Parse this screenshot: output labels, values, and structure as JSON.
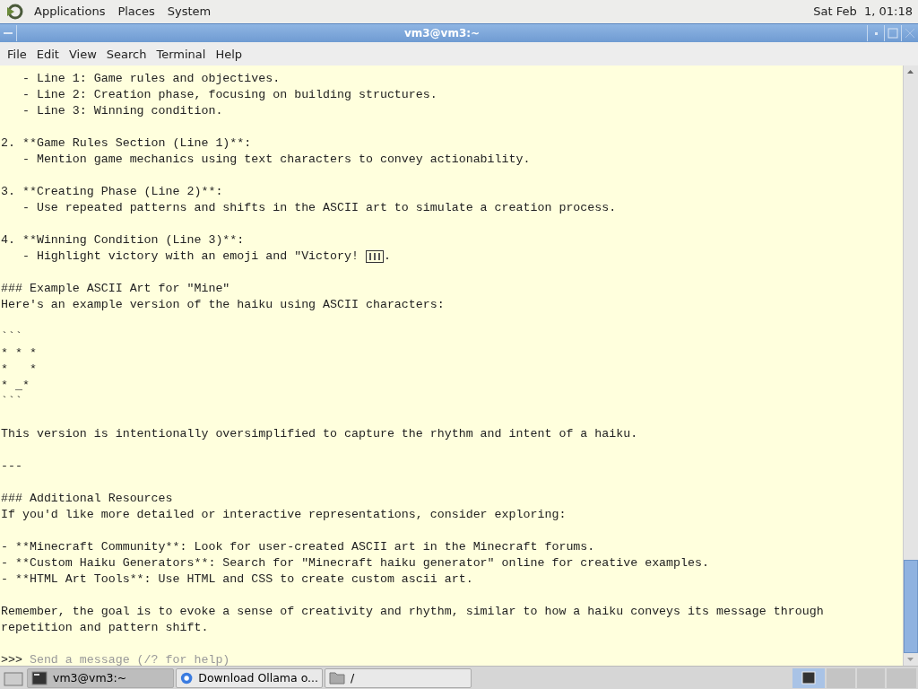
{
  "top_panel": {
    "menus": [
      "Applications",
      "Places",
      "System"
    ],
    "clock": "Sat Feb  1, 01:18"
  },
  "window": {
    "title": "vm3@vm3:~"
  },
  "menu_bar": [
    "File",
    "Edit",
    "View",
    "Search",
    "Terminal",
    "Help"
  ],
  "terminal": {
    "paragraphs": [
      {
        "lines": [
          {
            "text": "   - Line 1: Game rules and objectives."
          },
          {
            "text": "   - Line 2: Creation phase, focusing on building structures."
          },
          {
            "text": "   - Line 3: Winning condition."
          }
        ]
      },
      {
        "lines": [
          {
            "text": "2. **Game Rules Section (Line 1)**:"
          },
          {
            "text": "   - Mention game mechanics using text characters to convey actionability."
          }
        ]
      },
      {
        "lines": [
          {
            "text": "3. **Creating Phase (Line 2)**:"
          },
          {
            "text": "   - Use repeated patterns and shifts in the ASCII art to simulate a creation process."
          }
        ]
      },
      {
        "lines": [
          {
            "text": "4. **Winning Condition (Line 3)**:"
          },
          {
            "text": "   - Highlight victory with an emoji and \"Victory! ",
            "tail": "."
          }
        ]
      },
      {
        "lines": [
          {
            "text": "### Example ASCII Art for \"Mine\""
          },
          {
            "text": "Here's an example version of the haiku using ASCII characters:"
          }
        ]
      },
      {
        "lines": [
          {
            "text": "```"
          },
          {
            "text": "* * *"
          },
          {
            "text": "*   *"
          },
          {
            "text": "* _*"
          },
          {
            "text": "```"
          }
        ]
      },
      {
        "lines": [
          {
            "text": "This version is intentionally oversimplified to capture the rhythm and intent of a haiku."
          }
        ]
      },
      {
        "lines": [
          {
            "text": "---"
          }
        ]
      },
      {
        "lines": [
          {
            "text": "### Additional Resources"
          },
          {
            "text": "If you'd like more detailed or interactive representations, consider exploring:"
          }
        ]
      },
      {
        "lines": [
          {
            "text": "- **Minecraft Community**: Look for user-created ASCII art in the Minecraft forums."
          },
          {
            "text": "- **Custom Haiku Generators**: Search for \"Minecraft haiku generator\" online for creative examples."
          },
          {
            "text": "- **HTML Art Tools**: Use HTML and CSS to create custom ascii art."
          }
        ]
      },
      {
        "lines": [
          {
            "text": "Remember, the goal is to evoke a sense of creativity and rhythm, similar to how a haiku conveys its message through"
          },
          {
            "text": "repetition and pattern shift."
          }
        ]
      }
    ],
    "prompt": ">>> ",
    "placeholder": "Send a message (/? for help)"
  },
  "taskbar": [
    {
      "label": "vm3@vm3:~",
      "kind": "terminal",
      "selected": true
    },
    {
      "label": "Download Ollama o...",
      "kind": "browser",
      "selected": false
    },
    {
      "label": "/",
      "kind": "folder",
      "selected": false
    }
  ]
}
